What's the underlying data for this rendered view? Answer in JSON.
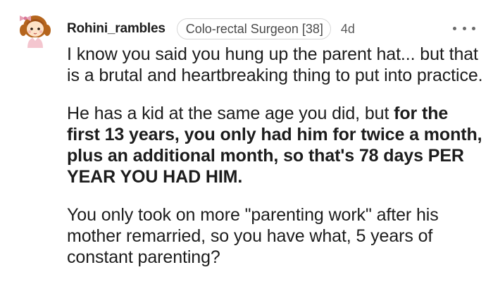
{
  "comment": {
    "author": "Rohini_rambles",
    "flair": "Colo-rectal Surgeon [38]",
    "timestamp": "4d",
    "more_icon": "more-horizontal-icon",
    "avatar_icon": "cartoon-girl-avatar-icon",
    "paragraphs": [
      {
        "plain_1": "I know you said you hung up the parent hat... but that is a brutal and heartbreaking thing to put into practice."
      },
      {
        "plain_1": "He has a kid at the same age you did, but ",
        "bold_1": "for the first 13 years, you only had him for twice a month, plus an additional month, so that's 78 days PER YEAR YOU HAD HIM."
      },
      {
        "plain_1": "You only took on more \"parenting work\" after his mother remarried, so you have what, 5 years of constant parenting?"
      }
    ]
  },
  "colors": {
    "text": "#1c1c1c",
    "meta": "#5a5a5a",
    "flair_border": "#d6d6d6",
    "avatar_hair": "#b5651d",
    "avatar_bow": "#e8a0b4",
    "avatar_shirt": "#f4c6cf"
  }
}
